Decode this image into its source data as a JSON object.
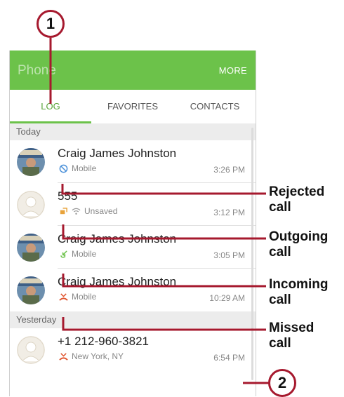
{
  "app": {
    "title": "Phone",
    "more_label": "MORE"
  },
  "tabs": [
    {
      "label": "LOG",
      "active": true
    },
    {
      "label": "FAVORITES",
      "active": false
    },
    {
      "label": "CONTACTS",
      "active": false
    }
  ],
  "sections": {
    "today": "Today",
    "yesterday": "Yesterday"
  },
  "calls": [
    {
      "name": "Craig James Johnston",
      "type": "rejected",
      "type_icon": "rejected-call-icon",
      "label": "Mobile",
      "time": "3:26 PM",
      "avatar": "photo"
    },
    {
      "name": "555",
      "type": "outgoing",
      "type_icon": "outgoing-wifi-call-icon",
      "label": "Unsaved",
      "time": "3:12 PM",
      "avatar": "placeholder"
    },
    {
      "name": "Craig James Johnston",
      "type": "incoming",
      "type_icon": "incoming-call-icon",
      "label": "Mobile",
      "time": "3:05 PM",
      "avatar": "photo"
    },
    {
      "name": "Craig James Johnston",
      "type": "missed",
      "type_icon": "missed-call-icon",
      "label": "Mobile",
      "time": "10:29 AM",
      "avatar": "photo"
    },
    {
      "name": "+1 212-960-3821",
      "type": "missed",
      "type_icon": "missed-call-icon",
      "label": "New York, NY",
      "time": "6:54 PM",
      "avatar": "placeholder"
    }
  ],
  "callouts": {
    "step1": "1",
    "step2": "2",
    "rejected_line1": "Rejected",
    "rejected_line2": "call",
    "outgoing_line1": "Outgoing",
    "outgoing_line2": "call",
    "incoming_line1": "Incoming",
    "incoming_line2": "call",
    "missed_line1": "Missed",
    "missed_line2": "call"
  },
  "colors": {
    "appbar": "#6cc24a",
    "callout": "#a6192e",
    "rejected": "#4a90d9",
    "incoming": "#6cc24a",
    "missed": "#e0542e",
    "outgoing": "#e8a23a"
  }
}
